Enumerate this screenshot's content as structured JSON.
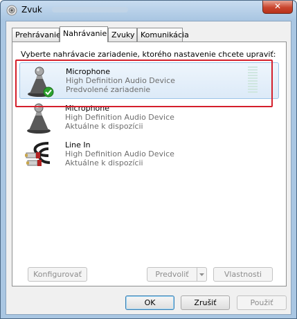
{
  "window": {
    "title": "Zvuk",
    "close_label": "✕"
  },
  "tabs": [
    {
      "label": "Prehrávanie",
      "active": false
    },
    {
      "label": "Nahrávanie",
      "active": true
    },
    {
      "label": "Zvuky",
      "active": false
    },
    {
      "label": "Komunikácia",
      "active": false
    }
  ],
  "panel": {
    "instruction": "Vyberte nahrávacie zariadenie, ktorého nastavenie chcete upraviť:"
  },
  "devices": [
    {
      "name": "Microphone",
      "subtitle": "High Definition Audio Device",
      "status": "Predvolené zariadenie",
      "icon": "microphone-default-icon",
      "selected": true
    },
    {
      "name": "Microphone",
      "subtitle": "High Definition Audio Device",
      "status": "Aktuálne k dispozícii",
      "icon": "microphone-icon",
      "selected": false
    },
    {
      "name": "Line In",
      "subtitle": "High Definition Audio Device",
      "status": "Aktuálne k dispozícii",
      "icon": "rca-cable-icon",
      "selected": false
    }
  ],
  "panel_buttons": {
    "configure": "Konfigurovať",
    "set_default": "Predvoliť",
    "properties": "Vlastnosti"
  },
  "dialog_buttons": {
    "ok": "OK",
    "cancel": "Zrušiť",
    "apply": "Použiť"
  },
  "colors": {
    "highlight_border": "#d41f2b",
    "selection": "#dceaf8",
    "default_check": "#2da32d"
  }
}
